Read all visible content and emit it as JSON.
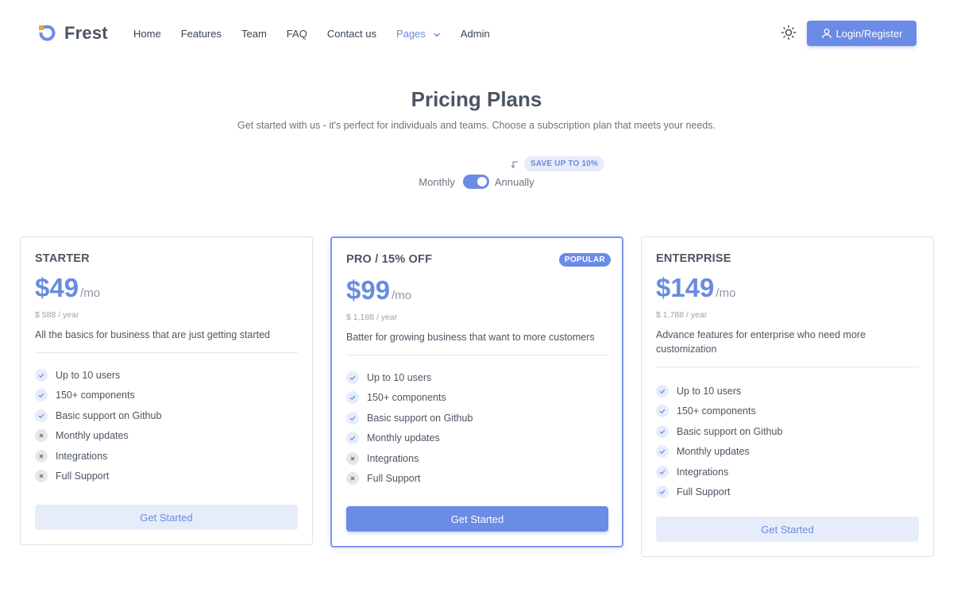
{
  "brand": {
    "name": "Frest"
  },
  "nav": {
    "links": [
      "Home",
      "Features",
      "Team",
      "FAQ",
      "Contact us"
    ],
    "pages_label": "Pages",
    "admin_label": "Admin",
    "login_label": "Login/Register"
  },
  "hero": {
    "title": "Pricing Plans",
    "subtitle": "Get started with us - it's perfect for individuals and teams. Choose a subscription plan that meets your needs."
  },
  "billing": {
    "save_badge": "SAVE UP TO 10%",
    "monthly_label": "Monthly",
    "annually_label": "Annually",
    "selected": "Annually"
  },
  "plans": [
    {
      "name": "STARTER",
      "price": "$49",
      "per": "/mo",
      "yearly": "$ 588 / year",
      "description": "All the basics for business that are just getting started",
      "features": [
        {
          "label": "Up to 10 users",
          "included": true
        },
        {
          "label": "150+ components",
          "included": true
        },
        {
          "label": "Basic support on Github",
          "included": true
        },
        {
          "label": "Monthly updates",
          "included": false
        },
        {
          "label": "Integrations",
          "included": false
        },
        {
          "label": "Full Support",
          "included": false
        }
      ],
      "cta": "Get Started"
    },
    {
      "name": "PRO / 15% OFF",
      "badge": "POPULAR",
      "price": "$99",
      "per": "/mo",
      "yearly": "$ 1,188 / year",
      "description": "Batter for growing business that want to more customers",
      "features": [
        {
          "label": "Up to 10 users",
          "included": true
        },
        {
          "label": "150+ components",
          "included": true
        },
        {
          "label": "Basic support on Github",
          "included": true
        },
        {
          "label": "Monthly updates",
          "included": true
        },
        {
          "label": "Integrations",
          "included": false
        },
        {
          "label": "Full Support",
          "included": false
        }
      ],
      "cta": "Get Started"
    },
    {
      "name": "ENTERPRISE",
      "price": "$149",
      "per": "/mo",
      "yearly": "$ 1,788 / year",
      "description": "Advance features for enterprise who need more customization",
      "features": [
        {
          "label": "Up to 10 users",
          "included": true
        },
        {
          "label": "150+ components",
          "included": true
        },
        {
          "label": "Basic support on Github",
          "included": true
        },
        {
          "label": "Monthly updates",
          "included": true
        },
        {
          "label": "Integrations",
          "included": true
        },
        {
          "label": "Full Support",
          "included": true
        }
      ],
      "cta": "Get Started"
    }
  ],
  "colors": {
    "primary": "#6a8be6",
    "primary_light": "#e7ecfb",
    "brand_orange": "#f5a623"
  }
}
